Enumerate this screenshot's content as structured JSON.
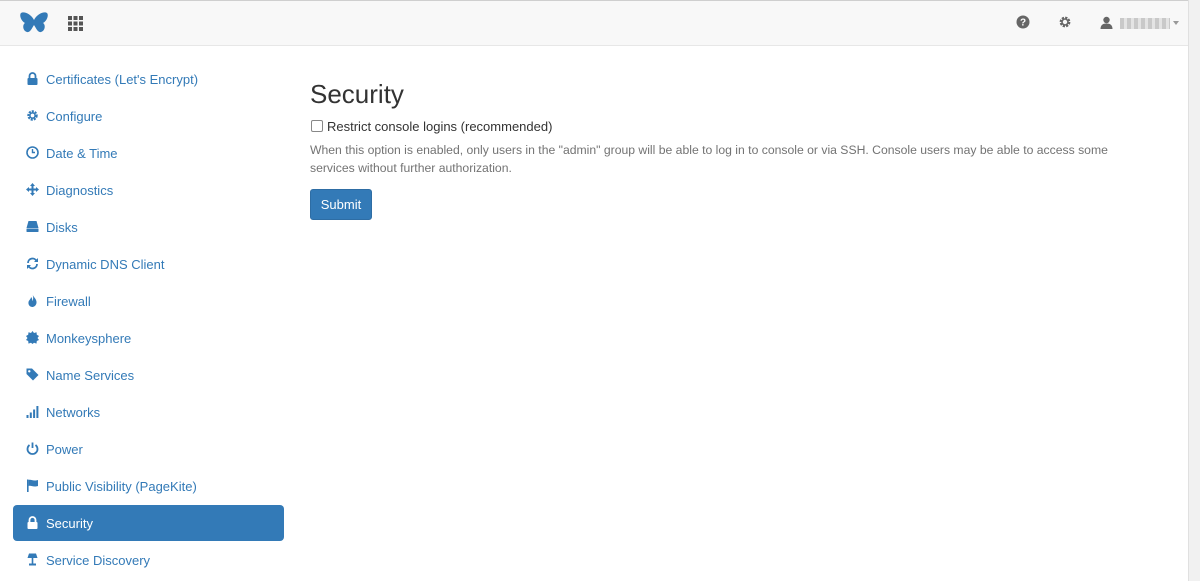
{
  "colors": {
    "link": "#337ab7",
    "active_bg": "#337ab7",
    "navbar_bg": "#f8f8f8"
  },
  "navbar": {
    "brand_icon": "butterfly-logo-icon",
    "apps_icon": "grid-icon",
    "help_icon": "question-circle-icon",
    "settings_icon": "gear-icon",
    "user_icon": "user-icon",
    "user_name": "username"
  },
  "sidebar": {
    "items": [
      {
        "label": "Certificates (Let's Encrypt)",
        "icon": "lock-icon"
      },
      {
        "label": "Configure",
        "icon": "gear-icon"
      },
      {
        "label": "Date & Time",
        "icon": "clock-icon"
      },
      {
        "label": "Diagnostics",
        "icon": "move-arrows-icon"
      },
      {
        "label": "Disks",
        "icon": "hdd-icon"
      },
      {
        "label": "Dynamic DNS Client",
        "icon": "refresh-icon"
      },
      {
        "label": "Firewall",
        "icon": "fire-icon"
      },
      {
        "label": "Monkeysphere",
        "icon": "certificate-icon"
      },
      {
        "label": "Name Services",
        "icon": "tag-icon"
      },
      {
        "label": "Networks",
        "icon": "signal-icon"
      },
      {
        "label": "Power",
        "icon": "power-icon"
      },
      {
        "label": "Public Visibility (PageKite)",
        "icon": "flag-icon"
      },
      {
        "label": "Security",
        "icon": "lock-icon",
        "active": true
      },
      {
        "label": "Service Discovery",
        "icon": "lamp-icon"
      }
    ]
  },
  "main": {
    "title": "Security",
    "checkbox_label": "Restrict console logins (recommended)",
    "checkbox_checked": false,
    "help_text": "When this option is enabled, only users in the \"admin\" group will be able to log in to console or via SSH. Console users may be able to access some services without further authorization.",
    "submit_label": "Submit"
  }
}
